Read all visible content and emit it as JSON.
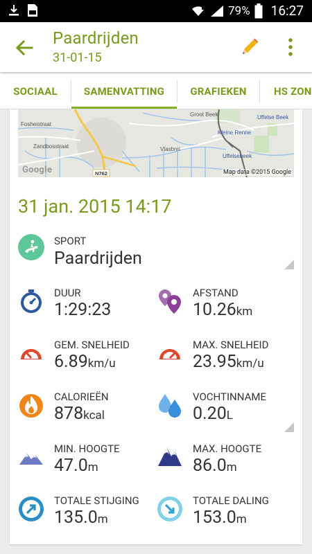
{
  "status_bar": {
    "battery": "79%",
    "time": "16:27"
  },
  "header": {
    "title": "Paardrijden",
    "date": "31-01-15"
  },
  "tabs": [
    "SOCIAAL",
    "SAMENVATTING",
    "GRAFIEKEN",
    "HS ZON"
  ],
  "map": {
    "credit": "Map data ©2015 Google",
    "logo": "Google",
    "road_label": "N762",
    "street_labels": [
      "Fosheistraat",
      "Zandbosstraat",
      "Vlasbrei",
      "Kleine Renne",
      "Uffelsebeek",
      "Uffelse Beek",
      "Groot Beek"
    ]
  },
  "workout": {
    "datetime": "31 jan. 2015 14:17",
    "sport_label": "SPORT",
    "sport_value": "Paardrijden"
  },
  "stats": [
    {
      "label": "DUUR",
      "value": "1:29:23",
      "unit": "",
      "icon": "stopwatch-icon"
    },
    {
      "label": "AFSTAND",
      "value": "10.26",
      "unit": "km",
      "icon": "location-pins-icon"
    },
    {
      "label": "GEM. SNELHEID",
      "value": "6.89",
      "unit": "km/u",
      "icon": "speedometer-icon"
    },
    {
      "label": "MAX. SNELHEID",
      "value": "23.95",
      "unit": "km/u",
      "icon": "speedometer-max-icon"
    },
    {
      "label": "CALORIEËN",
      "value": "878",
      "unit": "kcal",
      "icon": "flame-icon"
    },
    {
      "label": "VOCHTINNAME",
      "value": "0.20",
      "unit": "L",
      "icon": "water-drops-icon"
    },
    {
      "label": "MIN. HOOGTE",
      "value": "47.0",
      "unit": "m",
      "icon": "mountain-low-icon"
    },
    {
      "label": "MAX. HOOGTE",
      "value": "86.0",
      "unit": "m",
      "icon": "mountain-high-icon"
    },
    {
      "label": "TOTALE STIJGING",
      "value": "135.0",
      "unit": "m",
      "icon": "ascent-arrow-icon"
    },
    {
      "label": "TOTALE DALING",
      "value": "153.0",
      "unit": "m",
      "icon": "descent-arrow-icon"
    }
  ],
  "colors": {
    "accent": "#7a9a1c",
    "indicator": "#8aab27",
    "sport_green": "#5dc79a",
    "blue_dark": "#2c5aa0",
    "purple": "#8b3f96",
    "red": "#e0472a",
    "orange": "#f0861a",
    "blue_light": "#3a8fd9",
    "navy": "#2e3a88",
    "cyan": "#36a4d2"
  }
}
